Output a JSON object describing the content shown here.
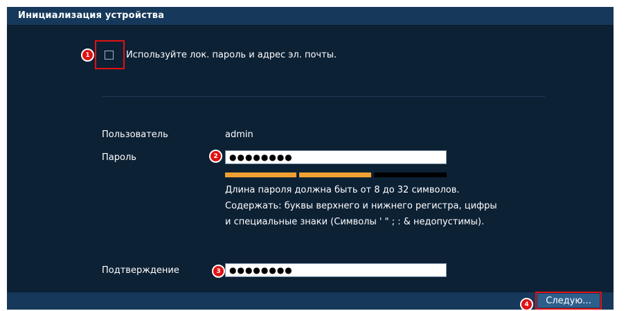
{
  "window": {
    "title": "Инициализация устройства"
  },
  "local_auth": {
    "checkbox_checked": false,
    "label": "Используйте лок. пароль и адрес эл. почты."
  },
  "form": {
    "user_label": "Пользователь",
    "user_value": "admin",
    "password_label": "Пароль",
    "password_value": "●●●●●●●●",
    "confirm_label": "Подтверждение",
    "confirm_value": "●●●●●●●●"
  },
  "strength_meter": {
    "segments": 3,
    "filled_segments": 2,
    "fill_color": "#f0a030",
    "empty_color": "#000000"
  },
  "hint": {
    "line1": "Длина пароля должна быть от 8 до 32 символов.",
    "line2": "Содержать: буквы верхнего и нижнего регистра, цифры",
    "line3": "и специальные знаки (Символы ' \" ; : & недопустимы)."
  },
  "footer": {
    "next_label": "Следую..."
  },
  "callouts": {
    "c1": "1",
    "c2": "2",
    "c3": "3",
    "c4": "4"
  },
  "colors": {
    "callout": "#e01212",
    "background": "#0d2135",
    "bar": "#16385a"
  }
}
